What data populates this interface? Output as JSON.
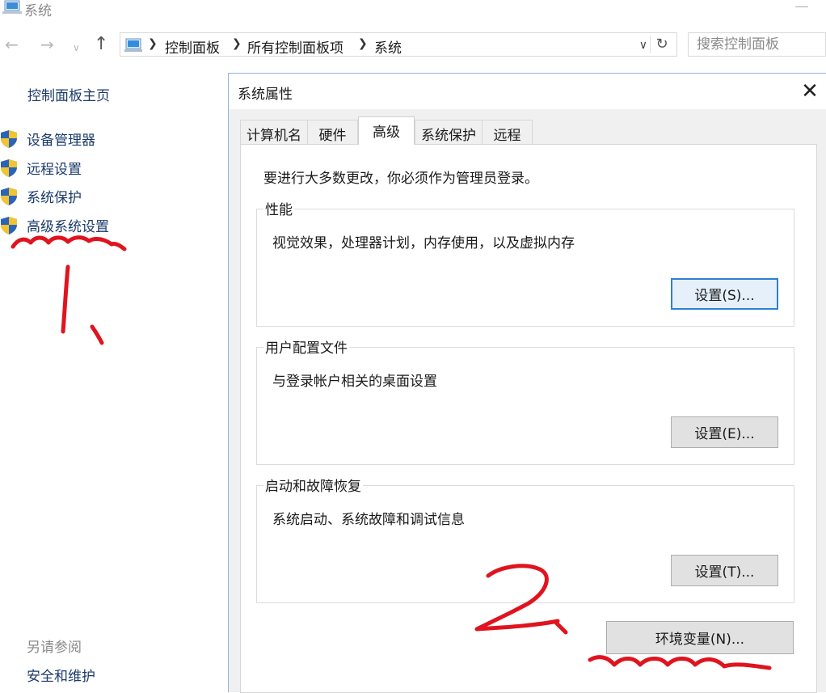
{
  "window": {
    "title": "系统",
    "breadcrumb": [
      "控制面板",
      "所有控制面板项",
      "系统"
    ],
    "search_placeholder": "搜索控制面板"
  },
  "sidebar": {
    "home": "控制面板主页",
    "items": [
      {
        "label": "设备管理器",
        "icon": "uac-shield-icon"
      },
      {
        "label": "远程设置",
        "icon": "uac-shield-icon"
      },
      {
        "label": "系统保护",
        "icon": "uac-shield-icon"
      },
      {
        "label": "高级系统设置",
        "icon": "uac-shield-icon"
      }
    ],
    "see_also_heading": "另请参阅",
    "see_also_links": [
      "安全和维护"
    ]
  },
  "dialog": {
    "title": "系统属性",
    "tabs": [
      "计算机名",
      "硬件",
      "高级",
      "系统保护",
      "远程"
    ],
    "active_tab": "高级",
    "notice": "要进行大多数更改，你必须作为管理员登录。",
    "groups": [
      {
        "title": "性能",
        "description": "视觉效果，处理器计划，内存使用，以及虚拟内存",
        "button": "设置(S)..."
      },
      {
        "title": "用户配置文件",
        "description": "与登录帐户相关的桌面设置",
        "button": "设置(E)..."
      },
      {
        "title": "启动和故障恢复",
        "description": "系统启动、系统故障和调试信息",
        "button": "设置(T)..."
      }
    ],
    "env_button": "环境变量(N)..."
  },
  "colors": {
    "annotation": "#e0141e",
    "focus_border": "#2f7fd6",
    "link": "#1a3a6a"
  }
}
